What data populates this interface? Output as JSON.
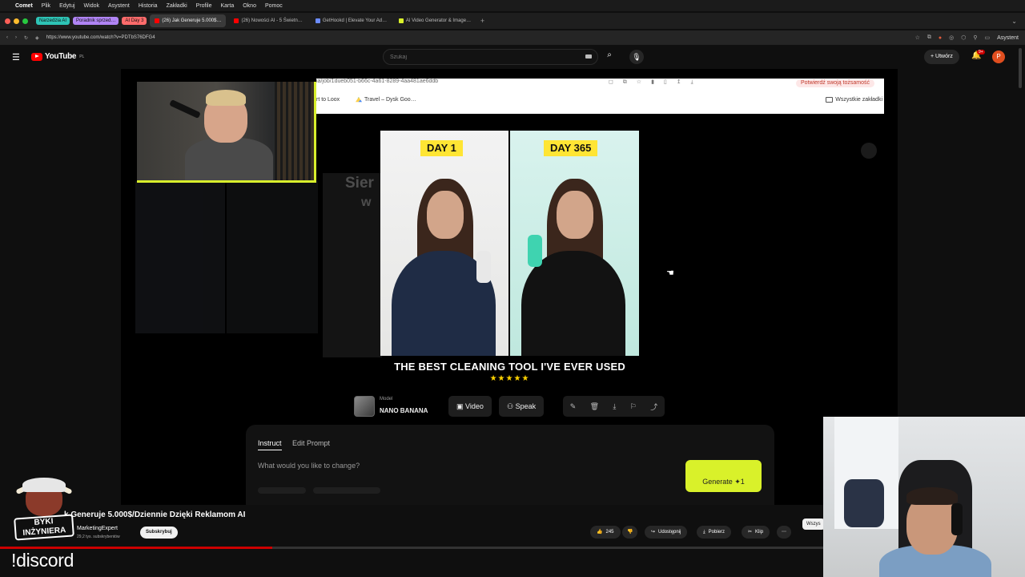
{
  "menubar": {
    "app": "Comet",
    "items": [
      "Plik",
      "Edytuj",
      "Widok",
      "Asystent",
      "Historia",
      "Zakładki",
      "Profile",
      "Karta",
      "Okno",
      "Pomoc"
    ]
  },
  "tabs": {
    "pills": [
      {
        "label": "Narzedzia AI",
        "color": "#2ec4b6"
      },
      {
        "label": "Poradnik sprzed…",
        "color": "#b084f5"
      },
      {
        "label": "AI Day 3",
        "color": "#ff6b6b"
      }
    ],
    "items": [
      {
        "label": "(26) Jak Generuje 5.000$…",
        "fav": "#ff0000",
        "active": true
      },
      {
        "label": "(26) Nowości AI - 5 Świetn…",
        "fav": "#ff0000",
        "active": false
      },
      {
        "label": "GetHookd | Elevate Your Ad…",
        "fav": "#6c8cff",
        "active": false
      },
      {
        "label": "AI Video Generator & Image…",
        "fav": "#d9f12a",
        "active": false
      }
    ],
    "new_tab": "+"
  },
  "address": {
    "url": "https://www.youtube.com/watch?v=PDTbS76DFG4",
    "assistant": "Asystent"
  },
  "youtube": {
    "logo": "YouTube",
    "region": "PL",
    "search_placeholder": "Szukaj",
    "create_label": "Utwórz",
    "notif_badge": "9+",
    "avatar_letter": "P"
  },
  "inner_browser": {
    "url_fragment": "ia/job/1dueb051-b66c-4a61-8289-4aa481ae6ddb",
    "verify": "Potwierdź swoją tożsamość",
    "bookmark_a": "rt to Loox",
    "bookmark_b": "Travel – Dysk Goo…",
    "bookmark_all": "Wszystkie zakładki"
  },
  "ghost": {
    "t1": "Sier",
    "t2": "w"
  },
  "product": {
    "day_left": "DAY 1",
    "day_right": "DAY 365",
    "tagline": "THE BEST CLEANING TOOL I'VE EVER USED",
    "stars": "★★★★★",
    "rating": 5,
    "model_small": "Model",
    "model_name": "NANO BANANA",
    "btn_video": "Video",
    "btn_speak": "Speak"
  },
  "editor": {
    "tab_instruct": "Instruct",
    "tab_edit": "Edit Prompt",
    "placeholder": "What would you like to change?",
    "generate": "Generate",
    "generate_cost": "1"
  },
  "meta": {
    "title": "k Generuje 5.000$/Dziennie Dzięki Reklamom AI",
    "channel": "MarketingExpert",
    "subs": "29,2 tys. subskrybentów",
    "subscribe": "Subskrybuj",
    "likes": "245",
    "share": "Udostępnij",
    "download": "Pobierz",
    "clip": "Klip",
    "partial_chip": "Wszys",
    "progress": 0.33
  },
  "overlay": {
    "logo_line1": "BYKI",
    "logo_line2": "INŻYNIERA",
    "discord": "!discord"
  }
}
